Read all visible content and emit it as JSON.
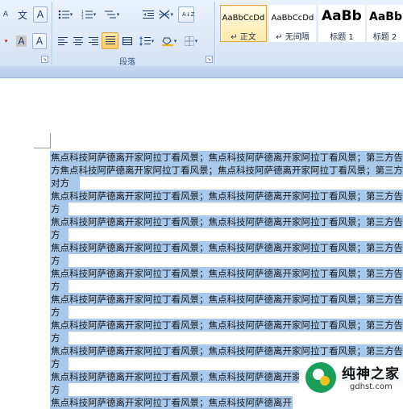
{
  "ribbon": {
    "font_group": {
      "phonetic_glyph": "文",
      "char_border_glyph": "A",
      "char_shading_glyph": "A",
      "font_color_glyph": "A"
    },
    "paragraph_group": {
      "label": "段落",
      "sort_glyph": "A↓Z"
    },
    "styles": [
      {
        "sample": "AaBbCcDd",
        "name": "↵ 正文",
        "selected": true
      },
      {
        "sample": "AaBbCcDd",
        "name": "↵ 无间隔",
        "selected": false
      },
      {
        "sample": "AaBb",
        "name": "标题 1",
        "selected": false
      },
      {
        "sample": "AaBb",
        "name": "标题 2",
        "selected": false
      }
    ],
    "highlight_color": "#f4d35e",
    "shading_accent": "#f0b400"
  },
  "document": {
    "selection_color": "#a9c9ea",
    "lines": [
      "焦点科技阿萨德离开家阿拉丁看风景；焦点科技阿萨德离开家阿拉丁看风景；第三方告诉",
      "方焦点科技阿萨德离开家阿拉丁看风景；焦点科技阿萨德离开家阿拉丁看风景；第三方告",
      "对方",
      "焦点科技阿萨德离开家阿拉丁看风景；焦点科技阿萨德离开家阿拉丁看风景；第三方告诉",
      "方",
      "焦点科技阿萨德离开家阿拉丁看风景；焦点科技阿萨德离开家阿拉丁看风景；第三方告诉",
      "方",
      "焦点科技阿萨德离开家阿拉丁看风景；焦点科技阿萨德离开家阿拉丁看风景；第三方告诉",
      "方",
      "焦点科技阿萨德离开家阿拉丁看风景；焦点科技阿萨德离开家阿拉丁看风景；第三方告诉",
      "方",
      "焦点科技阿萨德离开家阿拉丁看风景；焦点科技阿萨德离开家阿拉丁看风景；第三方告诉",
      "方",
      "焦点科技阿萨德离开家阿拉丁看风景；焦点科技阿萨德离开家阿拉丁看风景；第三方告诉",
      "方",
      "焦点科技阿萨德离开家阿拉丁看风景；焦点科技阿萨德离开家阿拉丁看风景；第三方告诉",
      "方",
      "焦点科技阿萨德离开家阿拉丁看风景；焦点科技阿萨德离开家阿拉丁看风景；第三方告诉",
      "方",
      "焦点科技阿萨德离开家阿拉丁看风景；焦点科技阿萨德离开家开"
    ]
  },
  "watermark": {
    "title": "纯神之家",
    "url": "gdhst.com"
  }
}
